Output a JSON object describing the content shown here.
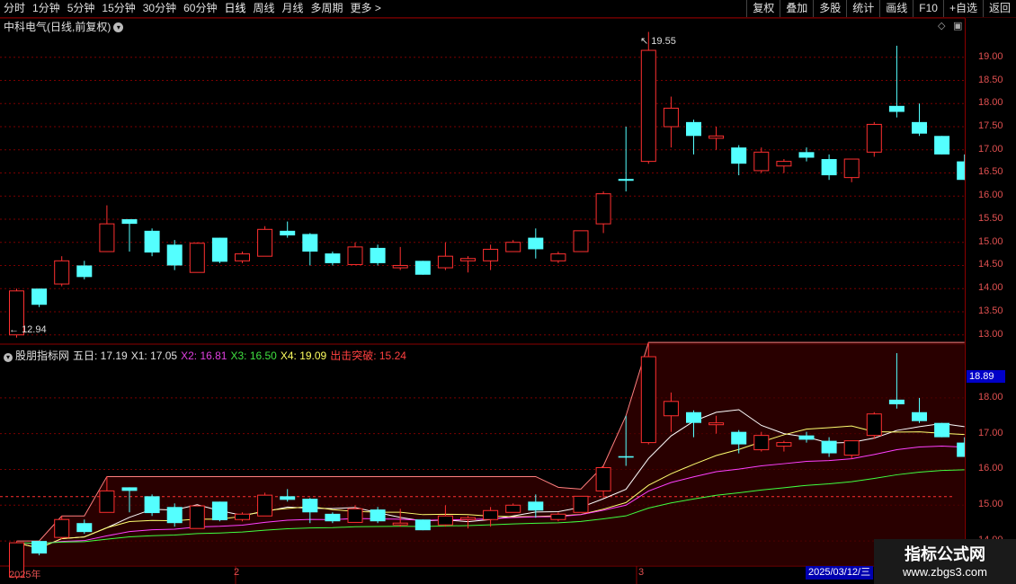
{
  "toolbar": {
    "periods": [
      "分时",
      "1分钟",
      "5分钟",
      "15分钟",
      "30分钟",
      "60分钟",
      "日线",
      "周线",
      "月线",
      "多周期",
      "更多 >"
    ],
    "active_period": "日线",
    "buttons": [
      "复权",
      "叠加",
      "多股",
      "统计",
      "画线",
      "F10",
      "+自选",
      "返回"
    ]
  },
  "main_panel": {
    "title": "中科电气(日线,前复权)",
    "high_label": "19.55",
    "low_label": "12.94",
    "yticks": [
      "19.00",
      "18.50",
      "18.00",
      "17.50",
      "17.00",
      "16.50",
      "16.00",
      "15.50",
      "15.00",
      "14.50",
      "14.00",
      "13.50",
      "13.00"
    ]
  },
  "indicator_panel": {
    "items": [
      {
        "text": "股朋指标网",
        "color": "#e0e0e0"
      },
      {
        "text": "五日: 17.19",
        "color": "#e0e0e0"
      },
      {
        "text": "X1: 17.05",
        "color": "#e0e0e0"
      },
      {
        "text": "X2: 16.81",
        "color": "#e040e0"
      },
      {
        "text": "X3: 16.50",
        "color": "#40e040"
      },
      {
        "text": "X4: 19.09",
        "color": "#ffff60"
      },
      {
        "text": "出击突破: 15.24",
        "color": "#ff4040"
      }
    ],
    "yticks": [
      "18.00",
      "17.00",
      "16.00",
      "15.00",
      "14.00"
    ],
    "current_value": "18.89"
  },
  "x_axis": {
    "labels": [
      "2025年",
      "2",
      "3"
    ],
    "cursor_date": "2025/03/12/三"
  },
  "watermark": {
    "title": "指标公式网",
    "url": "www.zbgs3.com"
  },
  "colors": {
    "up": "#ff3030",
    "down": "#54ffff",
    "grid": "#7a0000",
    "ma5": "#ffffff",
    "x1": "#ffff70",
    "x2": "#ff40ff",
    "x3": "#40ff40",
    "x4": "#ff8080"
  },
  "chart_data": {
    "type": "candlestick",
    "ohlc": [
      [
        13.0,
        14.0,
        12.94,
        13.95
      ],
      [
        14.0,
        14.0,
        13.6,
        13.65
      ],
      [
        14.1,
        14.7,
        14.05,
        14.6
      ],
      [
        14.5,
        14.6,
        14.2,
        14.25
      ],
      [
        14.8,
        15.8,
        14.8,
        15.4
      ],
      [
        15.5,
        15.5,
        14.8,
        15.4
      ],
      [
        15.25,
        15.3,
        14.7,
        14.78
      ],
      [
        14.95,
        15.05,
        14.4,
        14.5
      ],
      [
        14.35,
        15.0,
        14.35,
        14.98
      ],
      [
        15.1,
        15.1,
        14.55,
        14.58
      ],
      [
        14.6,
        14.8,
        14.55,
        14.75
      ],
      [
        14.7,
        15.35,
        14.7,
        15.28
      ],
      [
        15.25,
        15.45,
        15.1,
        15.15
      ],
      [
        15.18,
        15.2,
        14.5,
        14.8
      ],
      [
        14.76,
        14.8,
        14.5,
        14.55
      ],
      [
        14.52,
        15.0,
        14.52,
        14.9
      ],
      [
        14.88,
        14.95,
        14.5,
        14.55
      ],
      [
        14.45,
        14.9,
        14.4,
        14.5
      ],
      [
        14.6,
        14.6,
        14.3,
        14.3
      ],
      [
        14.45,
        15.0,
        14.4,
        14.7
      ],
      [
        14.6,
        14.7,
        14.35,
        14.65
      ],
      [
        14.6,
        14.95,
        14.4,
        14.85
      ],
      [
        14.8,
        15.05,
        14.8,
        15.0
      ],
      [
        15.1,
        15.3,
        14.65,
        14.85
      ],
      [
        14.6,
        14.8,
        14.55,
        14.75
      ],
      [
        14.8,
        15.25,
        14.8,
        15.25
      ],
      [
        15.4,
        16.1,
        15.2,
        16.05
      ],
      [
        16.37,
        17.5,
        16.1,
        16.33
      ],
      [
        16.75,
        19.55,
        16.7,
        19.15
      ],
      [
        17.5,
        18.15,
        17.05,
        17.9
      ],
      [
        17.6,
        17.65,
        16.9,
        17.3
      ],
      [
        17.25,
        17.5,
        17.0,
        17.3
      ],
      [
        17.05,
        17.1,
        16.45,
        16.7
      ],
      [
        16.55,
        17.05,
        16.5,
        16.95
      ],
      [
        16.65,
        16.8,
        16.5,
        16.75
      ],
      [
        16.95,
        17.05,
        16.75,
        16.83
      ],
      [
        16.8,
        16.9,
        16.35,
        16.45
      ],
      [
        16.4,
        16.8,
        16.3,
        16.8
      ],
      [
        16.95,
        17.6,
        16.85,
        17.55
      ],
      [
        17.95,
        19.25,
        17.7,
        17.82
      ],
      [
        17.6,
        18.0,
        17.3,
        17.35
      ],
      [
        17.3,
        17.3,
        16.9,
        16.9
      ],
      [
        16.75,
        16.9,
        16.35,
        16.35
      ]
    ],
    "ylim": [
      12.8,
      19.85
    ],
    "indicator_ylim": [
      13.3,
      19.0
    ]
  }
}
